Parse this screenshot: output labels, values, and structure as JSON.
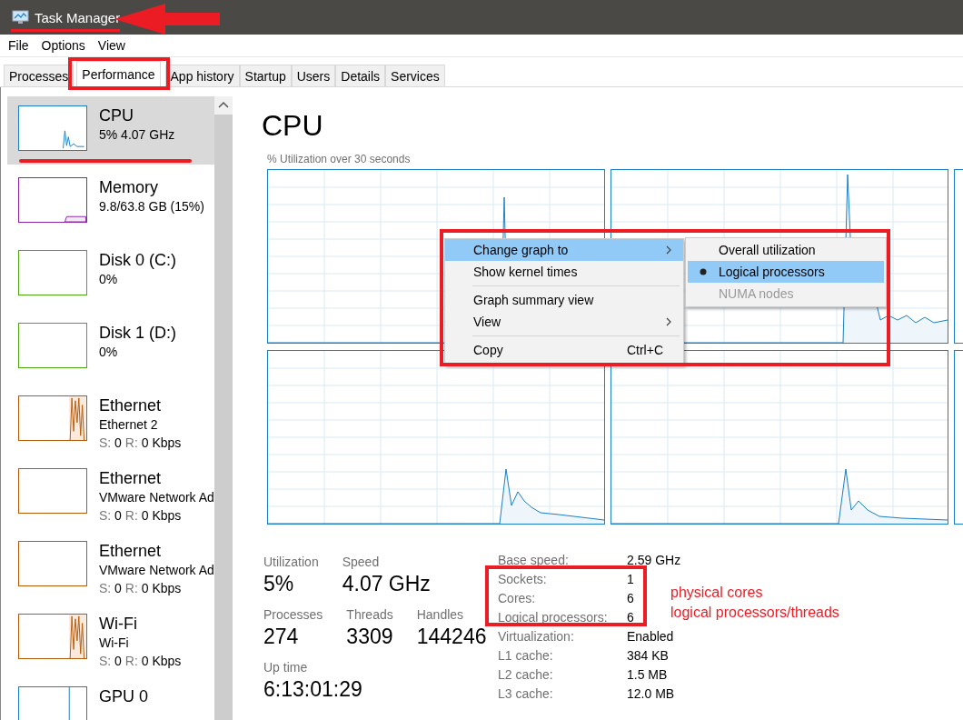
{
  "window": {
    "title": "Task Manager"
  },
  "menu": [
    "File",
    "Options",
    "View"
  ],
  "tabs": [
    {
      "label": "Processes",
      "selected": false
    },
    {
      "label": "Performance",
      "selected": true
    },
    {
      "label": "App history",
      "selected": false
    },
    {
      "label": "Startup",
      "selected": false
    },
    {
      "label": "Users",
      "selected": false
    },
    {
      "label": "Details",
      "selected": false
    },
    {
      "label": "Services",
      "selected": false
    }
  ],
  "sidebar": {
    "items": [
      {
        "kind": "cpu",
        "name": "CPU",
        "detail": "5%  4.07 GHz",
        "color": "#1b7fc4",
        "selected": true
      },
      {
        "kind": "memory",
        "name": "Memory",
        "detail": "9.8/63.8 GB (15%)",
        "color": "#8e24aa",
        "selected": false
      },
      {
        "kind": "disk",
        "name": "Disk 0 (C:)",
        "detail": "0%",
        "color": "#4caa14",
        "selected": false
      },
      {
        "kind": "disk",
        "name": "Disk 1 (D:)",
        "detail": "0%",
        "color": "#4caa14",
        "selected": false
      },
      {
        "kind": "network",
        "name": "Ethernet",
        "detail": "Ethernet 2",
        "send_label": "S:",
        "send": "0",
        "receive_label": "R:",
        "receive": "0 Kbps",
        "color": "#b35a0c",
        "selected": false
      },
      {
        "kind": "network",
        "name": "Ethernet",
        "detail": "VMware Network Ad",
        "send_label": "S:",
        "send": "0",
        "receive_label": "R:",
        "receive": "0 Kbps",
        "color": "#b35a0c",
        "selected": false
      },
      {
        "kind": "network",
        "name": "Ethernet",
        "detail": "VMware Network Ad",
        "send_label": "S:",
        "send": "0",
        "receive_label": "R:",
        "receive": "0 Kbps",
        "color": "#b35a0c",
        "selected": false
      },
      {
        "kind": "network",
        "name": "Wi-Fi",
        "detail": "Wi-Fi",
        "send_label": "S:",
        "send": "0",
        "receive_label": "R:",
        "receive": "0 Kbps",
        "color": "#b35a0c",
        "selected": false
      },
      {
        "kind": "gpu",
        "name": "GPU 0",
        "color": "#1b7fc4",
        "selected": false
      }
    ]
  },
  "main": {
    "title": "CPU",
    "graph_caption": "% Utilization over 30 seconds",
    "context_menu": {
      "items": [
        {
          "kind": "item",
          "label": "Change graph to",
          "submenu": true,
          "highlighted": true
        },
        {
          "kind": "item",
          "label": "Show kernel times",
          "submenu": false,
          "highlighted": false
        },
        {
          "kind": "separator"
        },
        {
          "kind": "item",
          "label": "Graph summary view",
          "submenu": false,
          "highlighted": false
        },
        {
          "kind": "item",
          "label": "View",
          "submenu": true,
          "highlighted": false
        },
        {
          "kind": "separator"
        },
        {
          "kind": "item",
          "label": "Copy",
          "shortcut": "Ctrl+C",
          "submenu": false,
          "highlighted": false
        }
      ]
    },
    "submenu": {
      "items": [
        {
          "label": "Overall utilization",
          "selected": false,
          "disabled": false
        },
        {
          "label": "Logical processors",
          "selected": true,
          "disabled": false
        },
        {
          "label": "NUMA nodes",
          "selected": false,
          "disabled": true
        }
      ]
    },
    "stats": [
      [
        {
          "label": "Utilization",
          "value": "5%"
        },
        {
          "label": "Speed",
          "value": "4.07 GHz"
        }
      ],
      [
        {
          "label": "Processes",
          "value": "274"
        },
        {
          "label": "Threads",
          "value": "3309"
        },
        {
          "label": "Handles",
          "value": "144246"
        }
      ],
      [
        {
          "label": "Up time",
          "value": "6:13:01:29"
        }
      ]
    ],
    "details": [
      {
        "label": "Base speed:",
        "value": "2.59 GHz"
      },
      {
        "label": "Sockets:",
        "value": "1"
      },
      {
        "label": "Cores:",
        "value": "6"
      },
      {
        "label": "Logical processors:",
        "value": "6"
      },
      {
        "label": "Virtualization:",
        "value": "Enabled"
      },
      {
        "label": "L1 cache:",
        "value": "384 KB"
      },
      {
        "label": "L2 cache:",
        "value": "1.5 MB"
      },
      {
        "label": "L3 cache:",
        "value": "12.0 MB"
      }
    ],
    "annotations": [
      "physical cores",
      "logical processors/threads"
    ]
  }
}
